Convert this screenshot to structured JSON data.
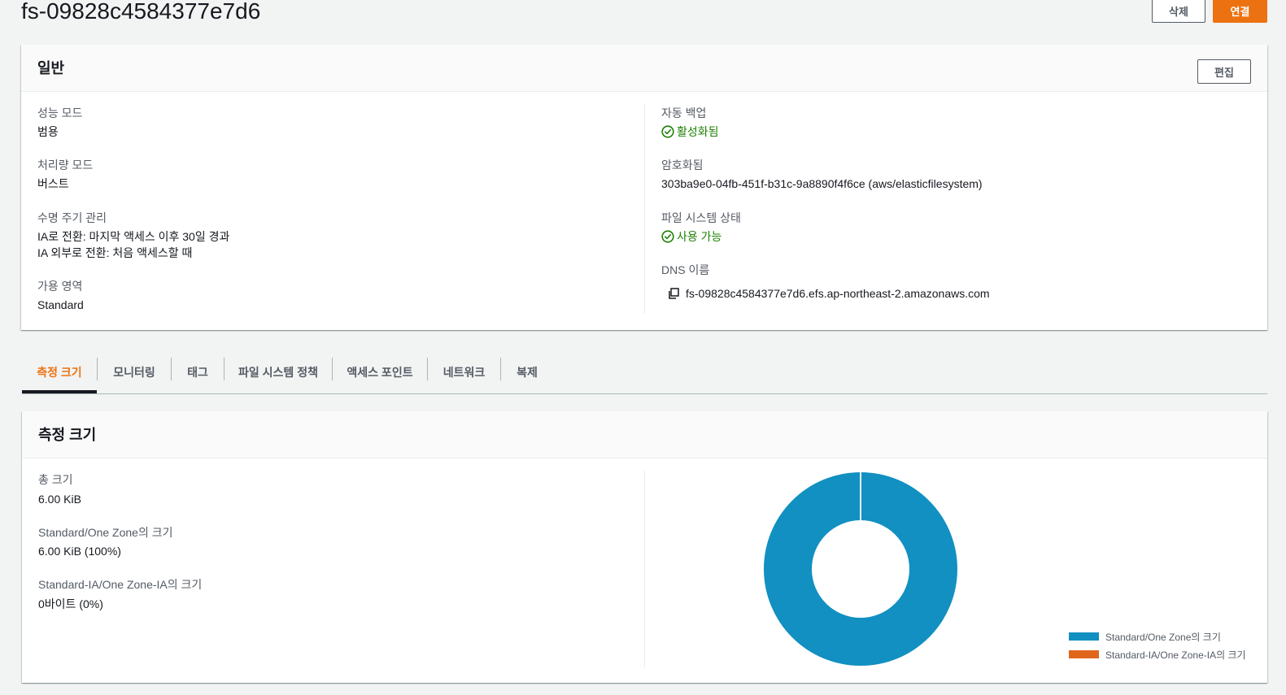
{
  "header": {
    "title": "fs-09828c4584377e7d6",
    "delete_label": "삭제",
    "connect_label": "연결"
  },
  "general": {
    "title": "일반",
    "edit_label": "편집",
    "performance_mode": {
      "label": "성능 모드",
      "value": "범용"
    },
    "throughput_mode": {
      "label": "처리량 모드",
      "value": "버스트"
    },
    "lifecycle": {
      "label": "수명 주기 관리",
      "line1": "IA로 전환: 마지막 액세스 이후 30일 경과",
      "line2": "IA 외부로 전환: 처음 액세스할 때"
    },
    "availability_zone": {
      "label": "가용 영역",
      "value": "Standard"
    },
    "auto_backup": {
      "label": "자동 백업",
      "value": "활성화됨"
    },
    "encryption": {
      "label": "암호화됨",
      "value": "303ba9e0-04fb-451f-b31c-9a8890f4f6ce (aws/elasticfilesystem)"
    },
    "fs_state": {
      "label": "파일 시스템 상태",
      "value": "사용 가능"
    },
    "dns": {
      "label": "DNS 이름",
      "value": "fs-09828c4584377e7d6.efs.ap-northeast-2.amazonaws.com"
    }
  },
  "tabs": [
    {
      "label": "측정 크기",
      "active": true
    },
    {
      "label": "모니터링"
    },
    {
      "label": "태그"
    },
    {
      "label": "파일 시스템 정책"
    },
    {
      "label": "액세스 포인트"
    },
    {
      "label": "네트워크"
    },
    {
      "label": "복제"
    }
  ],
  "metered_size": {
    "title": "측정 크기",
    "total": {
      "label": "총 크기",
      "value": "6.00 KiB"
    },
    "standard": {
      "label": "Standard/One Zone의 크기",
      "value": "6.00 KiB (100%)"
    },
    "ia": {
      "label": "Standard-IA/One Zone-IA의 크기",
      "value": "0바이트 (0%)"
    }
  },
  "chart_data": {
    "type": "pie",
    "series": [
      {
        "name": "Standard/One Zone의 크기",
        "value": 100,
        "color": "#1190c1"
      },
      {
        "name": "Standard-IA/One Zone-IA의 크기",
        "value": 0,
        "color": "#e0661c"
      }
    ]
  },
  "icons": {
    "status": "check-circle-icon",
    "copy": "copy-icon"
  },
  "colors": {
    "accent": "#ec7211",
    "success": "#1d8102",
    "standard_slice": "#1190c1",
    "ia_slice": "#e0661c"
  }
}
